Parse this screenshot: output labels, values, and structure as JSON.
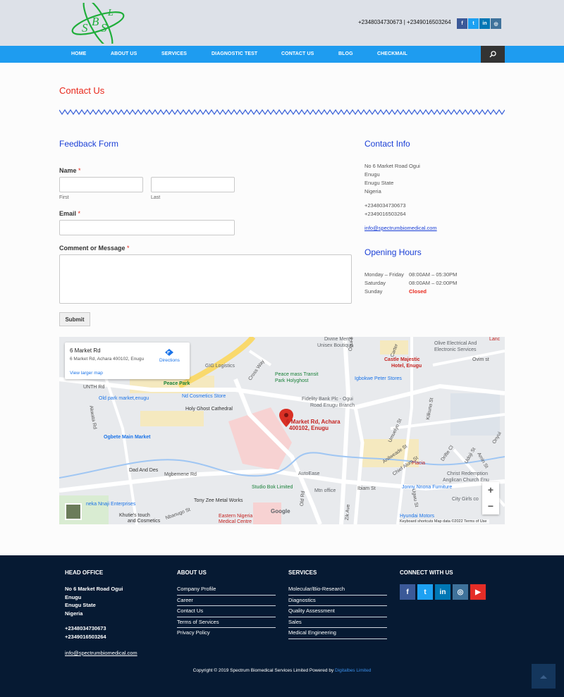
{
  "header": {
    "phones": "+2348034730673 | +2349016503264",
    "logo_letters": [
      "S",
      "B",
      "S",
      "L"
    ],
    "social": [
      {
        "icon": "facebook-icon",
        "glyph": "f",
        "color": "#3b5998"
      },
      {
        "icon": "twitter-icon",
        "glyph": "t",
        "color": "#1da1f2"
      },
      {
        "icon": "linkedin-icon",
        "glyph": "in",
        "color": "#0077b5"
      },
      {
        "icon": "instagram-icon",
        "glyph": "◎",
        "color": "#3f729b"
      }
    ]
  },
  "nav": {
    "items": [
      {
        "label": "HOME"
      },
      {
        "label": "ABOUT US"
      },
      {
        "label": "SERVICES"
      },
      {
        "label": "DIAGNOSTIC TEST"
      },
      {
        "label": "CONTACT US"
      },
      {
        "label": "BLOG"
      },
      {
        "label": "CHECKMAIL"
      }
    ],
    "search_icon": "search-icon"
  },
  "page": {
    "title": "Contact Us"
  },
  "form": {
    "heading": "Feedback Form",
    "name_label": "Name",
    "required_mark": "*",
    "first_label": "First",
    "last_label": "Last",
    "first_value": "",
    "last_value": "",
    "email_label": "Email",
    "email_value": "",
    "message_label": "Comment or Message",
    "message_value": "",
    "submit_label": "Submit"
  },
  "contact_info": {
    "heading": "Contact Info",
    "address": [
      "No 6 Market Road Ogui",
      "Enugu",
      "Enugu State",
      "Nigeria"
    ],
    "phones": [
      "+2348034730673",
      "+2349016503264"
    ],
    "email": "info@spectrumbiomedical.com"
  },
  "hours": {
    "heading": "Opening Hours",
    "rows": [
      {
        "day": "Monday – Friday",
        "time": "08:00AM – 05:30PM"
      },
      {
        "day": "Saturday",
        "time": "08:00AM – 02:00PM"
      },
      {
        "day": "Sunday",
        "time": "Closed"
      }
    ]
  },
  "map": {
    "card_title": "6 Market Rd",
    "card_address": "6 Market Rd, Achara 400102, Enugu",
    "larger_map": "View larger map",
    "directions": "Directions",
    "pin_label_1": "6 Market Rd, Achara",
    "pin_label_2": "400102, Enugu",
    "places": [
      "GIG Logistics",
      "Peace mass Transit",
      "Park Holyghost",
      "Igbokwe Peter Stores",
      "Peace Park",
      "Old park market,enugu",
      "Nd Cosmetics Store",
      "Holy Ghost Cathedral",
      "Fidelity Bank Plc - Ogui",
      "Road Enugu Branch",
      "Ogbete Main Market",
      "Dad And Des",
      "AutoEase",
      "Studio Bok Limited",
      "Mtn office",
      "Tony Zee Metal Works",
      "Khutie's touch",
      "and Cosmetics",
      "Eastern Nigeria",
      "Medical Centre",
      "Divine Mercy",
      "Unisex Boutique",
      "Olive Electrical And",
      "Electronic Services",
      "Castle Majestic",
      "Hotel, Enugu",
      "Placia",
      "Jonny Nnona Furniture",
      "Christ Redemption",
      "Anglican Church Enu",
      "City Girls co",
      "Hyundai Motors",
      "neka Nnaji Enterprises",
      "Lanc"
    ],
    "roads": [
      "Akwata Rd",
      "Mgbemene Rd",
      "Nbanugo St",
      "UNTH Rd",
      "Ogui Rd",
      "Zik Ave",
      "Old Rd",
      "Ibiam St",
      "Umuelyo St",
      "Anilweade St",
      "Chief Alum St",
      "Kilkuna St",
      "Udoji St",
      "Onyui",
      "Ovim st",
      "Amin St",
      "Drifte Cl",
      "Ugwu St",
      "Cross Way",
      "Carter"
    ],
    "footer": "Keyboard shortcuts    Map data ©2022    Terms of Use",
    "zoom_in": "+",
    "zoom_out": "−",
    "google": "Google"
  },
  "footer": {
    "head_office": {
      "heading": "HEAD OFFICE",
      "address": [
        "No 6 Market Road Ogui",
        "Enugu",
        "Enugu State",
        "Nigeria"
      ],
      "phones": [
        "+2348034730673",
        "+2349016503264"
      ],
      "email": "info@spectrumbiomedical.com"
    },
    "about": {
      "heading": "ABOUT US",
      "links": [
        "Company Profile",
        "Career",
        "Contact Us",
        "Terms of Services",
        "Privacy Policy"
      ]
    },
    "services": {
      "heading": "SERVICES",
      "links": [
        "Molecular/Bio-Research",
        "Diagnostics",
        "Quality Assessment",
        "Sales",
        "Medical Engineering"
      ]
    },
    "connect": {
      "heading": "CONNECT WITH US",
      "social": [
        {
          "icon": "facebook-icon",
          "glyph": "f",
          "color": "#3b5998"
        },
        {
          "icon": "twitter-icon",
          "glyph": "t",
          "color": "#1da1f2"
        },
        {
          "icon": "linkedin-icon",
          "glyph": "in",
          "color": "#0077b5"
        },
        {
          "icon": "instagram-icon",
          "glyph": "◎",
          "color": "#3f729b"
        },
        {
          "icon": "youtube-icon",
          "glyph": "▶",
          "color": "#e52d27"
        }
      ]
    },
    "copyright": "Copyright © 2019 Spectrum Biomedical Services Limited Powered by",
    "powered_by": "Digitalbes Limited",
    "to_top_icon": "chevron-up-icon"
  },
  "colors": {
    "nav": "#1e9cf0",
    "accent_red": "#e8261a",
    "heading_blue": "#1a3fd6",
    "footer_bg": "#061a33"
  }
}
